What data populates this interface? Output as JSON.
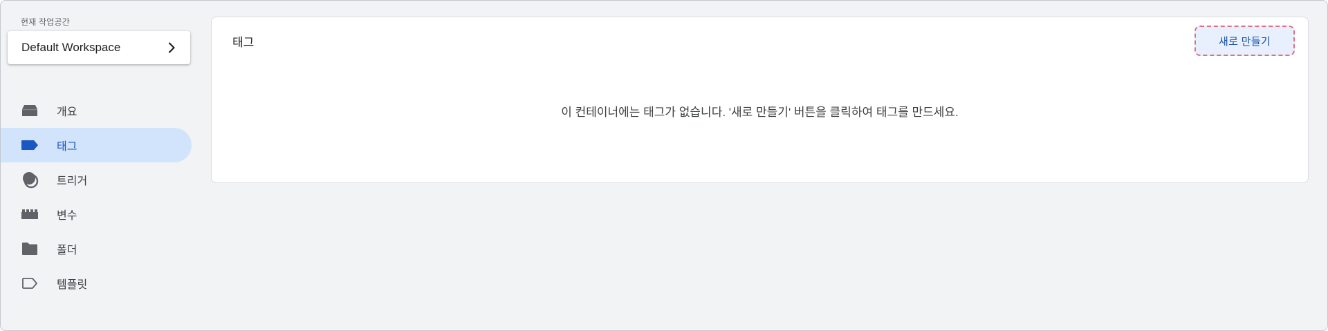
{
  "workspace": {
    "label": "현재 작업공간",
    "name": "Default Workspace"
  },
  "nav": {
    "items": [
      {
        "label": "개요",
        "icon": "overview-icon",
        "active": false
      },
      {
        "label": "태그",
        "icon": "tag-icon",
        "active": true
      },
      {
        "label": "트리거",
        "icon": "trigger-icon",
        "active": false
      },
      {
        "label": "변수",
        "icon": "variables-icon",
        "active": false
      },
      {
        "label": "폴더",
        "icon": "folder-icon",
        "active": false
      },
      {
        "label": "템플릿",
        "icon": "template-icon",
        "active": false
      }
    ]
  },
  "main": {
    "title": "태그",
    "new_button": "새로 만들기",
    "empty_message": "이 컨테이너에는 태그가 없습니다. '새로 만들기' 버튼을 클릭하여 태그를 만드세요."
  },
  "colors": {
    "active_bg": "#d2e3fc",
    "active_text": "#1a57c0",
    "button_bg": "#e8f0fe",
    "button_border": "#e0707f",
    "icon_gray": "#5f6368"
  }
}
